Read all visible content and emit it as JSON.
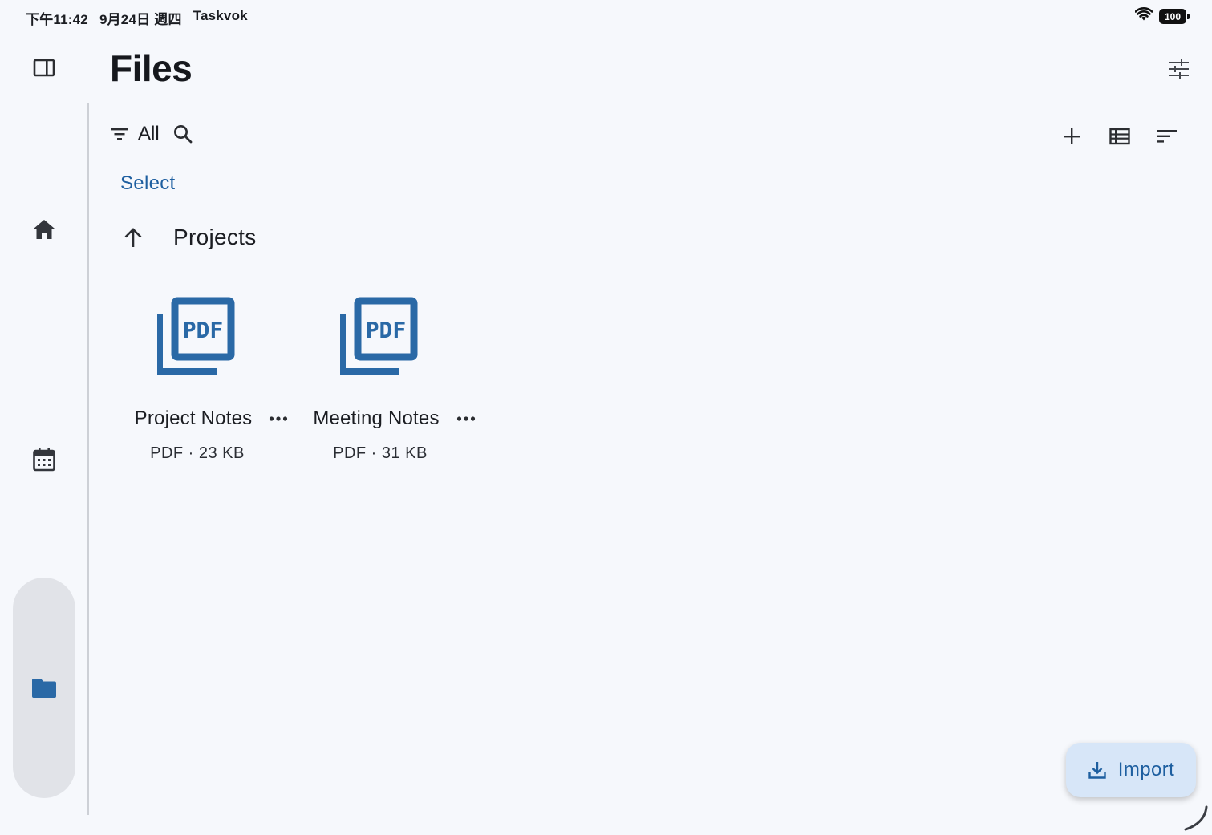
{
  "status_bar": {
    "time": "下午11:42",
    "date": "9月24日 週四",
    "app": "Taskvok",
    "battery": "100",
    "icons": [
      "wifi-icon",
      "battery-icon"
    ]
  },
  "rail": {
    "items": [
      {
        "name": "home",
        "icon": "home-icon",
        "selected": false
      },
      {
        "name": "calendar",
        "icon": "calendar-icon",
        "selected": false
      },
      {
        "name": "files",
        "icon": "folder-icon",
        "selected": true
      }
    ]
  },
  "header": {
    "title": "Files"
  },
  "toolbar": {
    "filter_label": "All",
    "icons": [
      "filter-icon",
      "search-icon",
      "add-icon",
      "list-view-icon",
      "sort-icon",
      "settings-sliders-icon"
    ]
  },
  "select_label": "Select",
  "folder": {
    "name": "Projects"
  },
  "files": [
    {
      "name": "Project Notes",
      "type": "PDF",
      "meta": "PDF · 23 KB"
    },
    {
      "name": "Meeting Notes",
      "type": "PDF",
      "meta": "PDF · 31 KB"
    }
  ],
  "fab": {
    "label": "Import"
  },
  "colors": {
    "accent": "#1e5fa0",
    "pdf_icon": "#2a69a6",
    "background": "#f6f8fc",
    "fab_background": "#d7e6f8",
    "rail_pill": "#e1e3e8"
  }
}
